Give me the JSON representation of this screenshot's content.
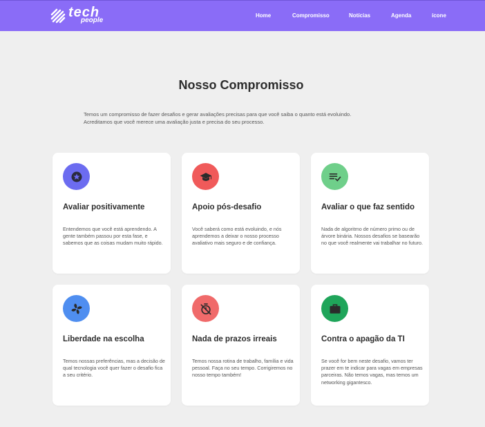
{
  "header": {
    "logo_word": "tech",
    "logo_subword": "people",
    "nav": [
      "Home",
      "Compromisso",
      "Notícias",
      "Agenda",
      "ícone"
    ],
    "brand_color": "#8a6cf7"
  },
  "main": {
    "title": "Nosso Compromisso",
    "intro_line1": "Temos um compromisso de fazer desafios e gerar avaliações precisas para que você saiba o quanto está evoluindo.",
    "intro_line2": "Acreditamos que você merece uma avaliação justa e precisa do seu processo."
  },
  "cards": [
    {
      "icon": "star-badge-icon",
      "color": "#6c6cf0",
      "title": "Avaliar positivamente",
      "text": "Entendemos que você está aprendendo. A gente também passou por esta fase, e sabemos que as coisas mudam muito rápido."
    },
    {
      "icon": "graduation-cap-icon",
      "color": "#f05a5a",
      "title": "Apoio pós-desafio",
      "text": "Você saberá como está evoluindo, e nós aprendemos a deixar o nosso processo avaliativo mais seguro e de confiança."
    },
    {
      "icon": "checklist-icon",
      "color": "#6fcf8a",
      "title": "Avaliar o que faz sentido",
      "text": "Nada de algoritmo de número primo ou de árvore binária. Nossos desafios se basearão no que você realmente vai trabalhar no futuro."
    },
    {
      "icon": "pinwheel-icon",
      "color": "#4f8ef0",
      "title": "Liberdade na escolha",
      "text": "Temos nossas preferências, mas a decisão de qual tecnologia você quer fazer o desafio fica a seu critério."
    },
    {
      "icon": "timer-off-icon",
      "color": "#f06a6a",
      "title": "Nada de prazos irreais",
      "text": "Temos nossa rotina de trabalho, família e vida pessoal. Faça no seu tempo. Corrigiremos no nosso tempo também!"
    },
    {
      "icon": "briefcase-icon",
      "color": "#1fa55a",
      "title": "Contra o apagão da TI",
      "text": "Se você for bem neste desafio, vamos ter prazer em te indicar para vagas em empresas parceiras. Não temos vagas, mas temos um networking gigantesco."
    }
  ]
}
